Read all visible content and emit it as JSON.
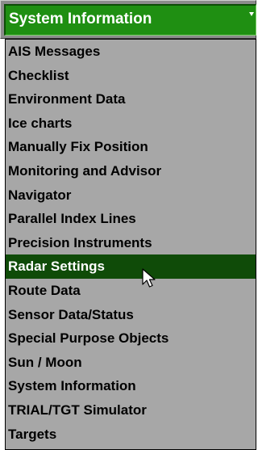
{
  "combo": {
    "selected_value": "System Information",
    "arrow_icon": "chevron-down-icon"
  },
  "list": {
    "items": [
      {
        "label": "AIS Messages"
      },
      {
        "label": "Checklist"
      },
      {
        "label": "Environment Data"
      },
      {
        "label": "Ice charts"
      },
      {
        "label": "Manually Fix Position"
      },
      {
        "label": "Monitoring and Advisor"
      },
      {
        "label": "Navigator"
      },
      {
        "label": "Parallel Index Lines"
      },
      {
        "label": "Precision Instruments"
      },
      {
        "label": "Radar Settings",
        "highlighted": true
      },
      {
        "label": "Route Data"
      },
      {
        "label": "Sensor Data/Status"
      },
      {
        "label": "Special Purpose Objects"
      },
      {
        "label": "Sun / Moon"
      },
      {
        "label": "System Information"
      },
      {
        "label": "TRIAL/TGT Simulator"
      },
      {
        "label": "Targets"
      }
    ]
  },
  "colors": {
    "combo_field_bg": "#1f8f12",
    "list_bg": "#a7a7a7",
    "highlight_bg": "#0f4b08"
  },
  "cursor_icon": "mouse-pointer-icon"
}
